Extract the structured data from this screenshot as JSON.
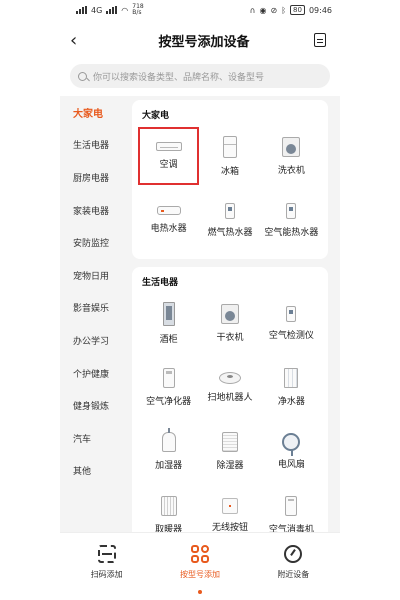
{
  "status": {
    "signal_text": "4G",
    "network_speed": "718 B/s",
    "battery": "80",
    "time": "09:46"
  },
  "header": {
    "title": "按型号添加设备",
    "back_glyph": "‹"
  },
  "search": {
    "placeholder": "你可以搜索设备类型、品牌名称、设备型号"
  },
  "sidebar": {
    "items": [
      {
        "label": "大家电"
      },
      {
        "label": "生活电器"
      },
      {
        "label": "厨房电器"
      },
      {
        "label": "家装电器"
      },
      {
        "label": "安防监控"
      },
      {
        "label": "宠物日用"
      },
      {
        "label": "影音娱乐"
      },
      {
        "label": "办公学习"
      },
      {
        "label": "个护健康"
      },
      {
        "label": "健身锻炼"
      },
      {
        "label": "汽车"
      },
      {
        "label": "其他"
      }
    ]
  },
  "sections": [
    {
      "title": "大家电",
      "devices": [
        {
          "label": "空调",
          "icon": "air-conditioner-icon"
        },
        {
          "label": "冰箱",
          "icon": "fridge-icon"
        },
        {
          "label": "洗衣机",
          "icon": "washing-machine-icon"
        },
        {
          "label": "电热水器",
          "icon": "electric-water-heater-icon"
        },
        {
          "label": "燃气热水器",
          "icon": "gas-water-heater-icon"
        },
        {
          "label": "空气能热水器",
          "icon": "air-energy-water-heater-icon"
        }
      ]
    },
    {
      "title": "生活电器",
      "devices": [
        {
          "label": "酒柜",
          "icon": "wine-cabinet-icon"
        },
        {
          "label": "干衣机",
          "icon": "dryer-icon"
        },
        {
          "label": "空气检测仪",
          "icon": "air-monitor-icon"
        },
        {
          "label": "空气净化器",
          "icon": "air-purifier-icon"
        },
        {
          "label": "扫地机器人",
          "icon": "robot-vacuum-icon"
        },
        {
          "label": "净水器",
          "icon": "water-purifier-icon"
        },
        {
          "label": "加湿器",
          "icon": "humidifier-icon"
        },
        {
          "label": "除湿器",
          "icon": "dehumidifier-icon"
        },
        {
          "label": "电风扇",
          "icon": "electric-fan-icon"
        },
        {
          "label": "取暖器",
          "icon": "heater-icon"
        },
        {
          "label": "无线按钮",
          "icon": "wireless-button-icon"
        },
        {
          "label": "空气消毒机",
          "icon": "air-disinfector-icon"
        }
      ]
    }
  ],
  "tabs": [
    {
      "label": "扫码添加",
      "icon": "scan-icon"
    },
    {
      "label": "按型号添加",
      "icon": "model-grid-icon"
    },
    {
      "label": "附近设备",
      "icon": "nearby-icon"
    }
  ],
  "colors": {
    "accent": "#e85a1e",
    "selection": "#e03030",
    "background": "#f4f4f4"
  }
}
